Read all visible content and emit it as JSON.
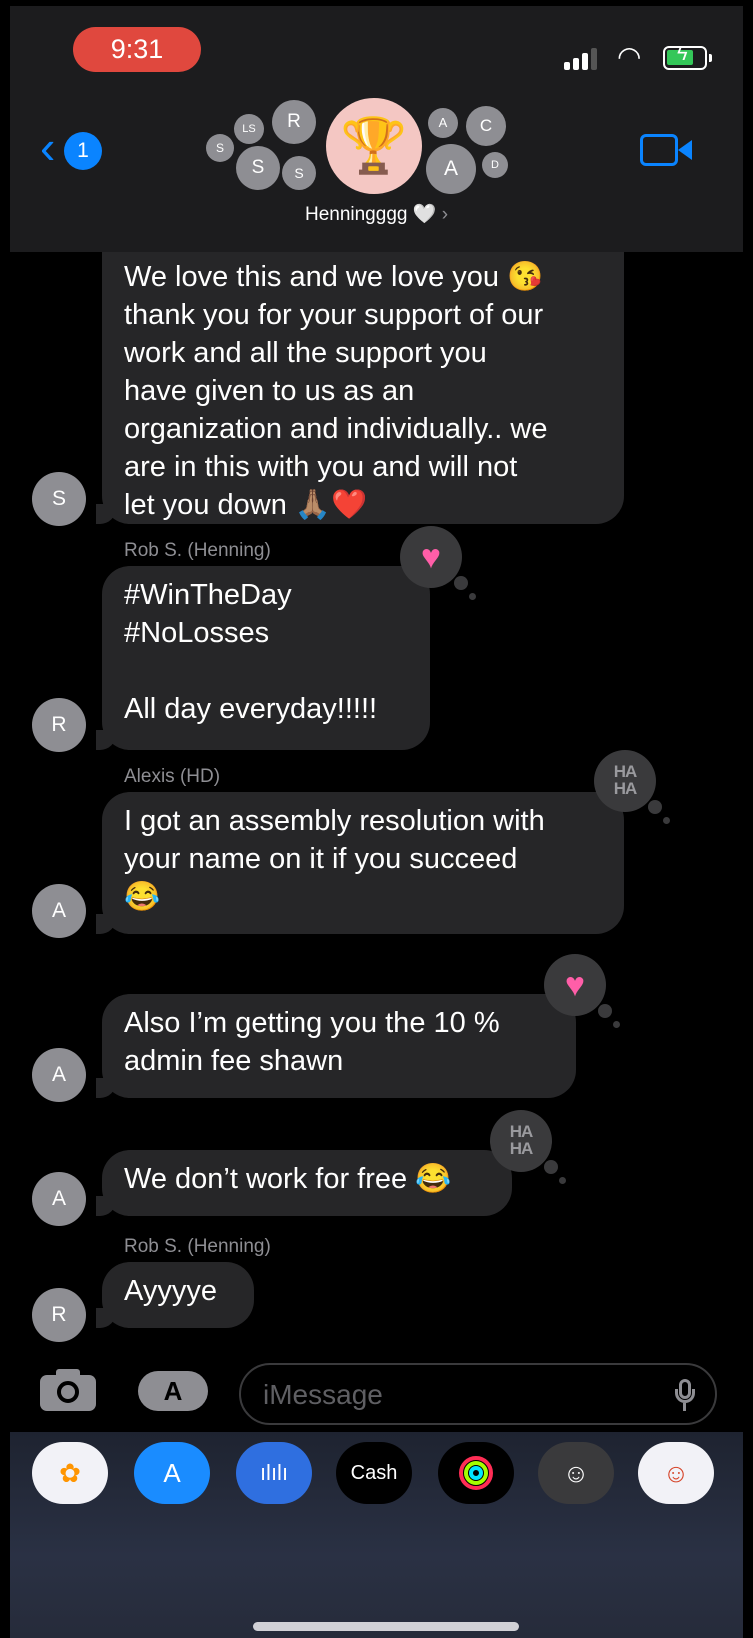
{
  "status_bar": {
    "time": "9:31"
  },
  "header": {
    "back_badge": "1",
    "group_name": "Henningggg",
    "group_name_suffix": "🤍",
    "participant_avatars": [
      "S",
      "LS",
      "R",
      "S",
      "S",
      "A",
      "C",
      "A",
      "D"
    ],
    "group_icon": "trophy-icon"
  },
  "messages": [
    {
      "sender_label": "",
      "avatar": "S",
      "text": "We love this and we love you 😘\nthank you for your support of our\nwork and all the support you\nhave given to us as an\norganization and individually.. we\nare in this with you and will not\nlet you down 🙏🏽❤️",
      "tapback": ""
    },
    {
      "sender_label": "Rob S. (Henning)",
      "avatar": "R",
      "text": "#WinTheDay\n#NoLosses\n\nAll day everyday!!!!!",
      "tapback": "heart"
    },
    {
      "sender_label": "Alexis (HD)",
      "avatar": "A",
      "text": "I got an assembly resolution with\nyour name on it if you succeed\n😂",
      "tapback": "haha"
    },
    {
      "sender_label": "",
      "avatar": "A",
      "text": "Also I’m getting you the 10 %\nadmin fee shawn",
      "tapback": "heart"
    },
    {
      "sender_label": "",
      "avatar": "A",
      "text": "We don’t work for free 😂",
      "tapback": "haha"
    },
    {
      "sender_label": "Rob S. (Henning)",
      "avatar": "R",
      "text": "Ayyyye",
      "tapback": ""
    }
  ],
  "tapback_labels": {
    "haha_line1": "HA",
    "haha_line2": "HA",
    "heart": "♥"
  },
  "input": {
    "placeholder": "iMessage"
  },
  "app_tray": [
    {
      "name": "photos-app",
      "label": ""
    },
    {
      "name": "app-store-app",
      "label": ""
    },
    {
      "name": "audio-message-app",
      "label": ""
    },
    {
      "name": "apple-cash-app",
      "label": "Cash"
    },
    {
      "name": "fitness-app",
      "label": ""
    },
    {
      "name": "memoji-app",
      "label": ""
    },
    {
      "name": "memoji-stickers-app",
      "label": ""
    }
  ],
  "colors": {
    "accent": "#0a84ff",
    "bubble": "#262628",
    "heart": "#ff5ea8",
    "time_pill": "#e0483e"
  }
}
